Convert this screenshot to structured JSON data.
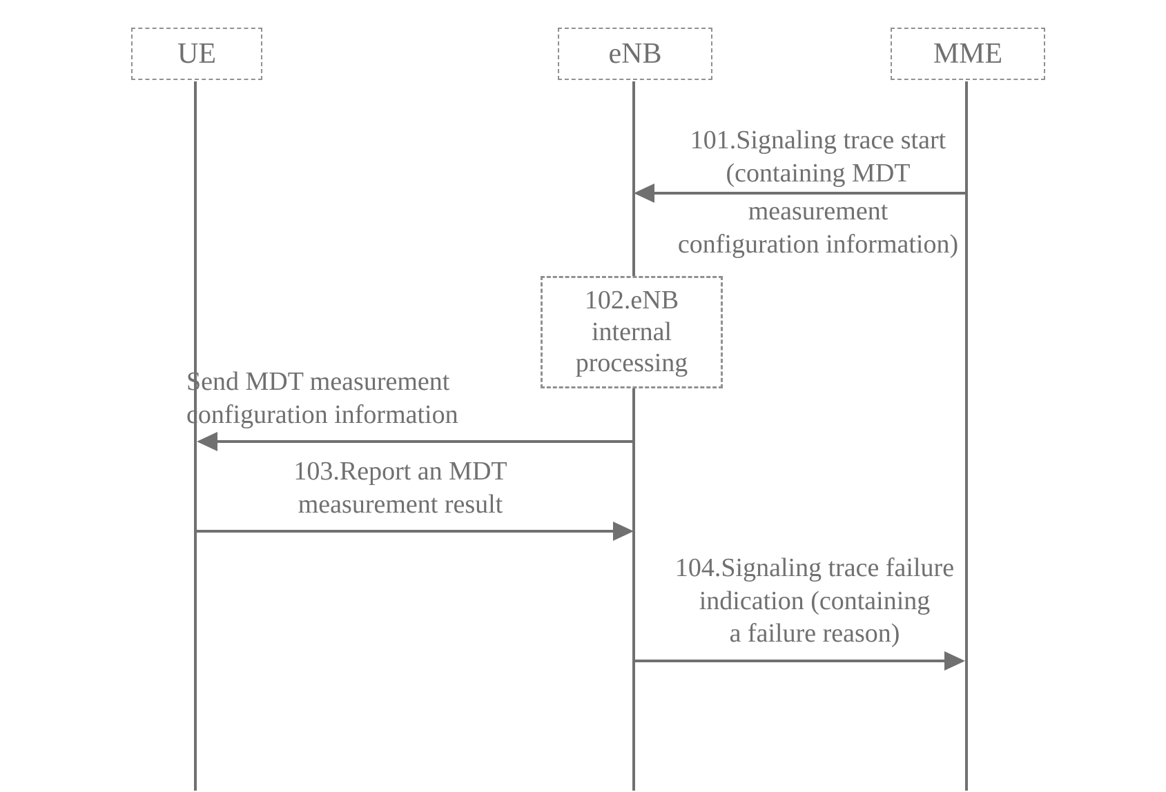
{
  "participants": {
    "ue": "UE",
    "enb": "eNB",
    "mme": "MME"
  },
  "messages": {
    "m101_l1": "101.Signaling trace start",
    "m101_l2": "(containing MDT",
    "m101_l3": "measurement",
    "m101_l4": "configuration information)",
    "m102_l1": "102.eNB",
    "m102_l2": "internal",
    "m102_l3": "processing",
    "sendcfg_l1": "Send MDT measurement",
    "sendcfg_l2": "configuration information",
    "m103_l1": "103.Report an MDT",
    "m103_l2": "measurement result",
    "m104_l1": "104.Signaling trace failure",
    "m104_l2": "indication (containing",
    "m104_l3": "a failure reason)"
  }
}
